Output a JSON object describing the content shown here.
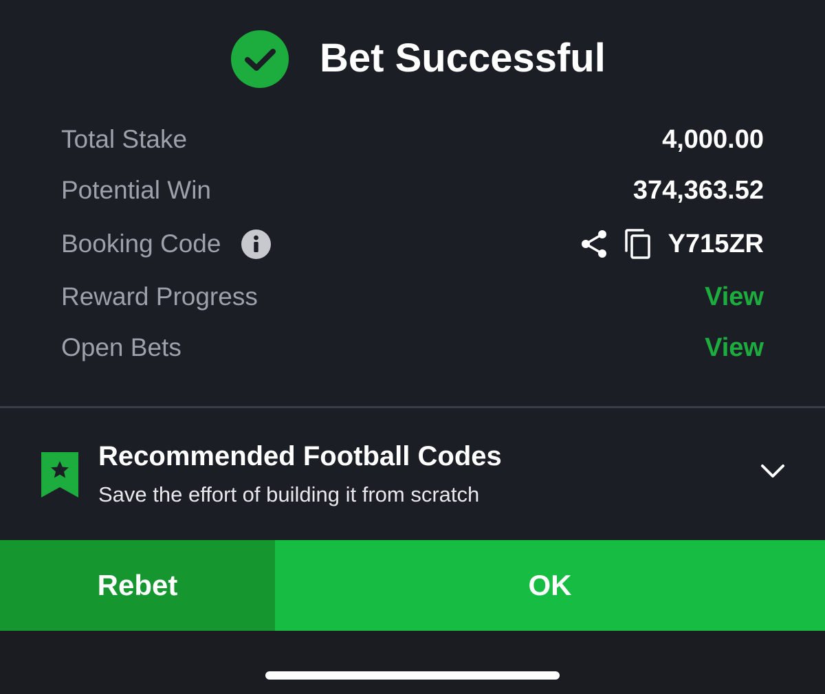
{
  "header": {
    "title": "Bet Successful",
    "icon": "check-circle-icon",
    "accent_color": "#1dac3e"
  },
  "summary": {
    "total_stake": {
      "label": "Total Stake",
      "value": "4,000.00"
    },
    "potential_win": {
      "label": "Potential Win",
      "value": "374,363.52"
    },
    "booking_code": {
      "label": "Booking Code",
      "value": "Y715ZR",
      "icons": [
        "info-icon",
        "share-icon",
        "copy-icon"
      ]
    },
    "reward_progress": {
      "label": "Reward Progress",
      "link": "View"
    },
    "open_bets": {
      "label": "Open Bets",
      "link": "View"
    }
  },
  "recommended": {
    "title": "Recommended Football Codes",
    "subtitle": "Save the effort of building it from scratch",
    "icon": "bookmark-star-icon"
  },
  "actions": {
    "rebet_label": "Rebet",
    "ok_label": "OK",
    "rebet_color": "#15962f",
    "ok_color": "#17bd43"
  }
}
